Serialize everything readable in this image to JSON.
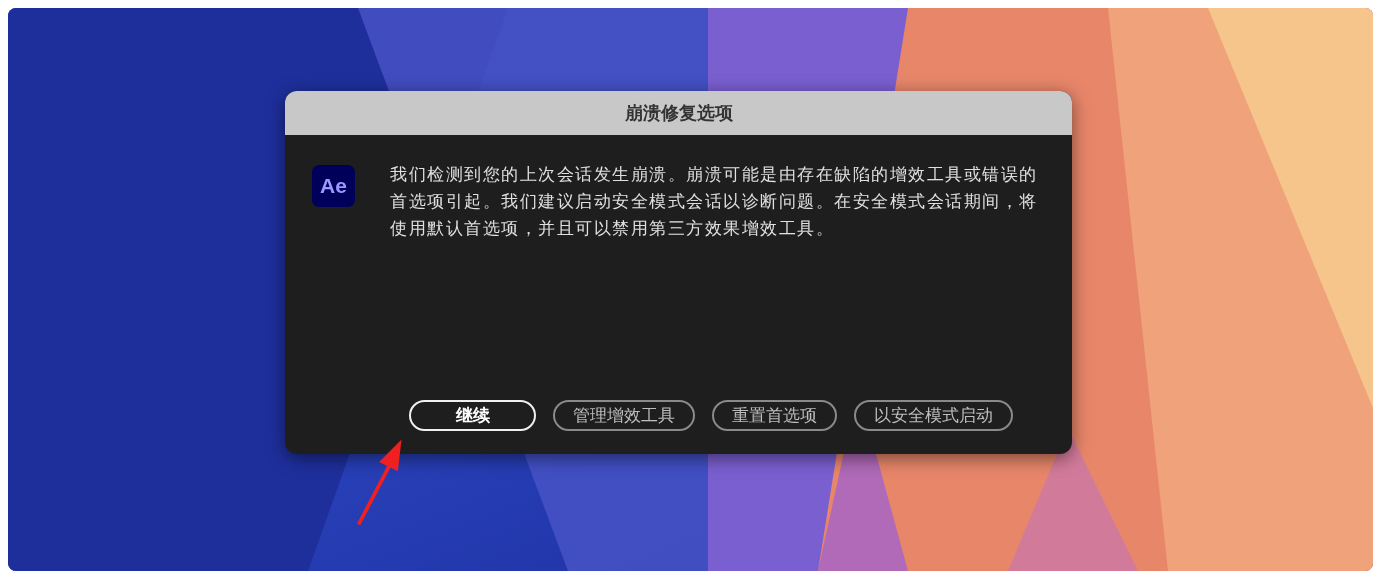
{
  "dialog": {
    "title": "崩溃修复选项",
    "app_icon": "Ae",
    "message": "我们检测到您的上次会话发生崩溃。崩溃可能是由存在缺陷的增效工具或错误的首选项引起。我们建议启动安全模式会话以诊断问题。在安全模式会话期间，将使用默认首选项，并且可以禁用第三方效果增效工具。",
    "buttons": [
      {
        "label": "继续",
        "selected": true
      },
      {
        "label": "管理增效工具",
        "selected": false
      },
      {
        "label": "重置首选项",
        "selected": false
      },
      {
        "label": "以安全模式启动",
        "selected": false
      }
    ]
  }
}
